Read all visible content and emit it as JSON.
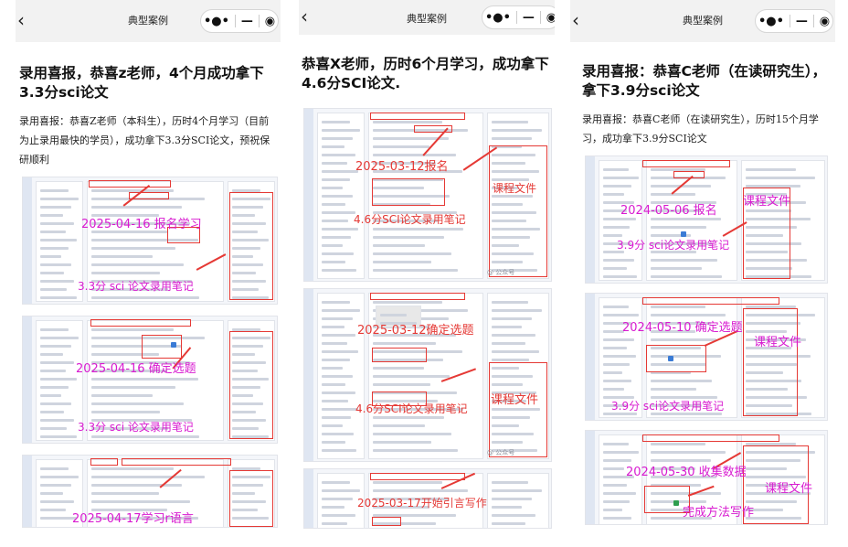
{
  "panels": [
    {
      "nav_title": "典型案例",
      "headline": "录用喜报，恭喜z老师，4个月成功拿下3.3分sci论文",
      "body": "录用喜报：恭喜Z老师（本科生），历时4个月学习（目前为止录用最快的学员），成功拿下3.3分SCI论文，预祝保研顺利",
      "shots": [
        {
          "labels": [
            "2025-04-16 报名学习",
            "3.3分 sci 论文录用笔记"
          ]
        },
        {
          "labels": [
            "2025-04-16 确定选题",
            "3.3分 sci 论文录用笔记"
          ]
        },
        {
          "labels": [
            "2025-04-17学习r语言"
          ]
        }
      ]
    },
    {
      "nav_title": "典型案例",
      "headline": "恭喜X老师，历时6个月学习，成功拿下4.6分SCI论文.",
      "body": "",
      "shots": [
        {
          "labels": [
            "2025-03-12报名",
            "4.6分SCI论文录用笔记",
            "课程文件"
          ]
        },
        {
          "labels": [
            "2025-03-12确定选题",
            "4.6分SCI论文录用笔记",
            "课程文件"
          ]
        },
        {
          "labels": [
            "2025-03-17开始引言写作"
          ]
        }
      ]
    },
    {
      "nav_title": "典型案例",
      "headline": "录用喜报：恭喜C老师（在读研究生），拿下3.9分sci论文",
      "body": "录用喜报：恭喜C老师（在读研究生），历时15个月学习，成功拿下3.9分SCI论文",
      "shots": [
        {
          "labels": [
            "2024-05-06 报名",
            "3.9分 sci论文录用笔记",
            "课程文件"
          ]
        },
        {
          "labels": [
            "2024-05-10 确定选题",
            "3.9分 sci论文录用笔记",
            "课程文件"
          ]
        },
        {
          "labels": [
            "2024-05-30 收集数据",
            "完成方法写作",
            "课程文件"
          ]
        }
      ]
    }
  ],
  "icons": {
    "back": "chevron-left-icon",
    "more": "more-dots-icon",
    "minimize": "minimize-icon",
    "close": "target-close-icon"
  },
  "colors": {
    "annotation_magenta": "#d81ad0",
    "annotation_red": "#e53935",
    "topbar": "#f2f2f2"
  }
}
